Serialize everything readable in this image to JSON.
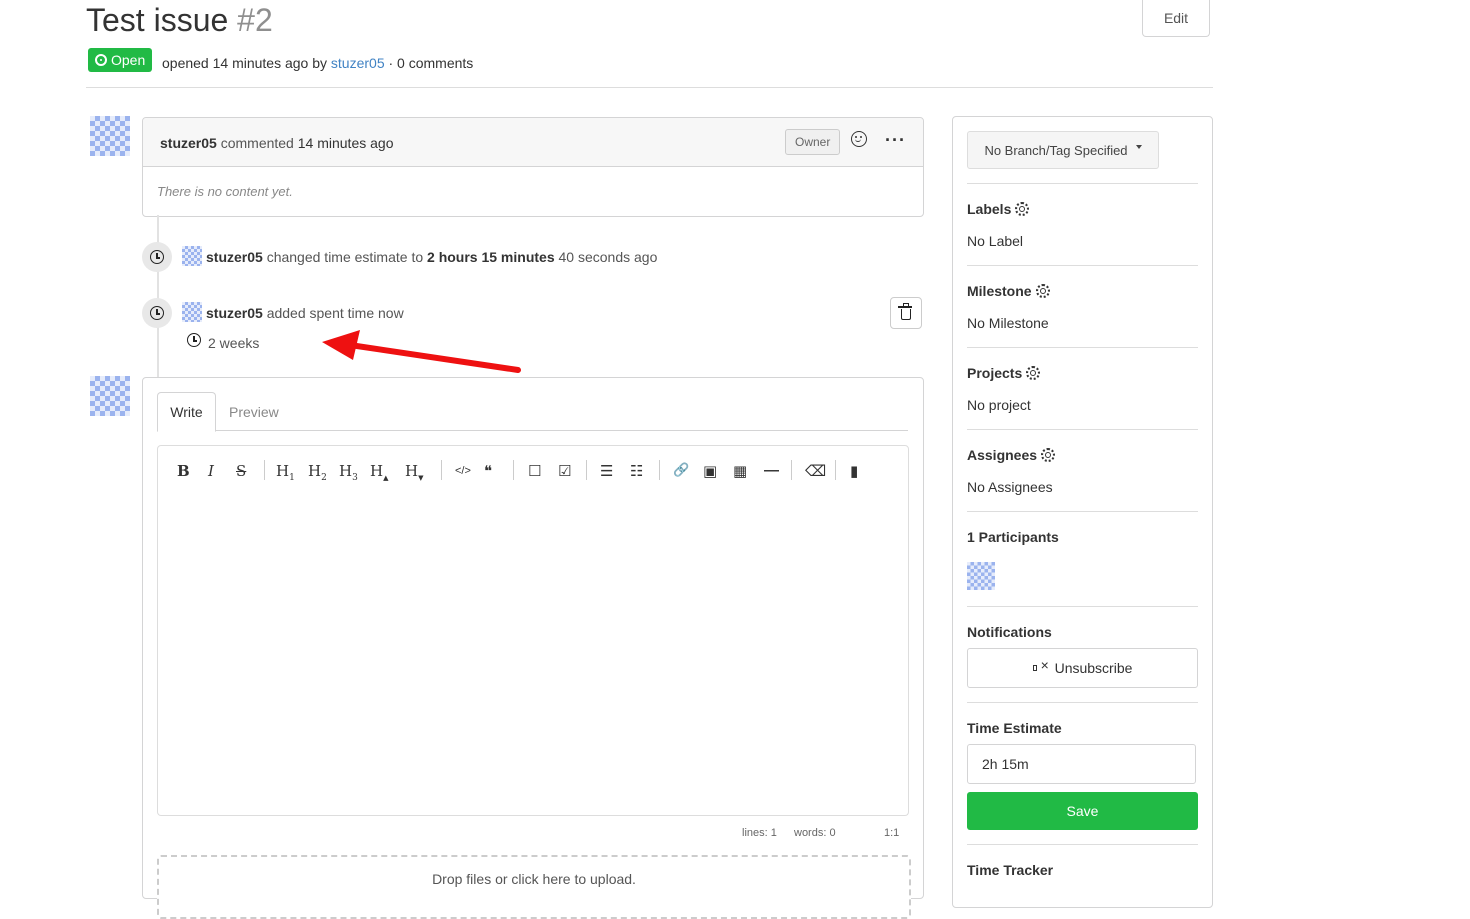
{
  "issue": {
    "title": "Test issue",
    "number": "#2",
    "edit_label": "Edit",
    "status": "Open",
    "opened_text": "opened 14 minutes ago by",
    "author": "stuzer05",
    "comments_text": "· 0 comments"
  },
  "comment": {
    "author": "stuzer05",
    "action": "commented",
    "time": "14 minutes ago",
    "role": "Owner",
    "body": "There is no content yet."
  },
  "events": [
    {
      "author": "stuzer05",
      "text_before": "changed time estimate to",
      "value": "2 hours 15 minutes",
      "text_after": "40 seconds ago"
    },
    {
      "author": "stuzer05",
      "text": "added spent time now",
      "duration": "2 weeks"
    }
  ],
  "editor": {
    "tabs": [
      "Write",
      "Preview"
    ],
    "toolbar": {
      "bold": "B",
      "italic": "I",
      "strike": "S",
      "h1": "H",
      "h2": "H",
      "h3": "H",
      "hbig": "H",
      "hsmall": "H",
      "h1_sub": "1",
      "h2_sub": "2",
      "h3_sub": "3",
      "code": "</>",
      "quote": "❝",
      "checkbox": "☐",
      "checked": "☑",
      "ul": "☰",
      "ol": "☷",
      "link": "🔗",
      "image": "▣",
      "table": "▦",
      "hr": "—",
      "eraser": "⌫",
      "file": "▮"
    },
    "status": {
      "lines": "lines: 1",
      "words": "words: 0",
      "cursor": "1:1"
    },
    "dropzone": "Drop files or click here to upload."
  },
  "sidebar": {
    "branch": "No Branch/Tag Specified",
    "labels_title": "Labels",
    "labels_value": "No Label",
    "milestone_title": "Milestone",
    "milestone_value": "No Milestone",
    "projects_title": "Projects",
    "projects_value": "No project",
    "assignees_title": "Assignees",
    "assignees_value": "No Assignees",
    "participants_title": "1 Participants",
    "notifications_title": "Notifications",
    "unsubscribe_label": "Unsubscribe",
    "time_estimate_title": "Time Estimate",
    "time_estimate_value": "2h 15m",
    "save_label": "Save",
    "time_tracker_title": "Time Tracker"
  },
  "colors": {
    "open_badge": "#21ba45",
    "save_button": "#21ba45",
    "link": "#4183c4",
    "annotation_arrow": "#ee1111"
  }
}
